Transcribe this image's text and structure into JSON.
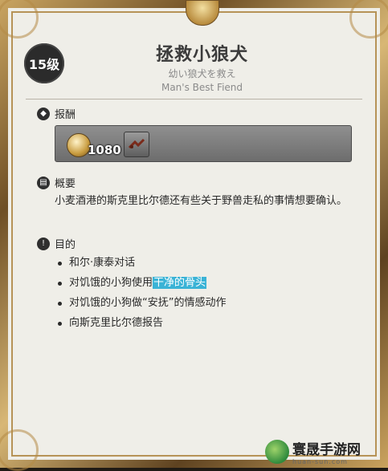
{
  "quest": {
    "level": "15级",
    "title": "拯救小狼犬",
    "subtitle_jp": "幼い狼犬を救え",
    "subtitle_en": "Man's Best Fiend"
  },
  "reward": {
    "heading": "报酬",
    "gil_amount": "1080",
    "gil_icon": "gil-coin-icon",
    "item_icon": "item-icon"
  },
  "summary": {
    "heading": "概要",
    "text": "小麦酒港的斯克里比尔德还有些关于野兽走私的事情想要确认。"
  },
  "objectives": {
    "heading": "目的",
    "items": [
      {
        "text": "和尔·康泰对话"
      },
      {
        "before": "对饥饿的小狗使用",
        "highlight": "干净的骨头"
      },
      {
        "text": "对饥饿的小狗做“安抚”的情感动作"
      },
      {
        "text": "向斯克里比尔德报告"
      }
    ]
  },
  "watermark": {
    "name": "寰晟手游网",
    "url": "huan-sun.com"
  },
  "colors": {
    "highlight": "#3ab3d6",
    "frame_gold": "#c9a461",
    "panel_bg": "#efeee8"
  }
}
